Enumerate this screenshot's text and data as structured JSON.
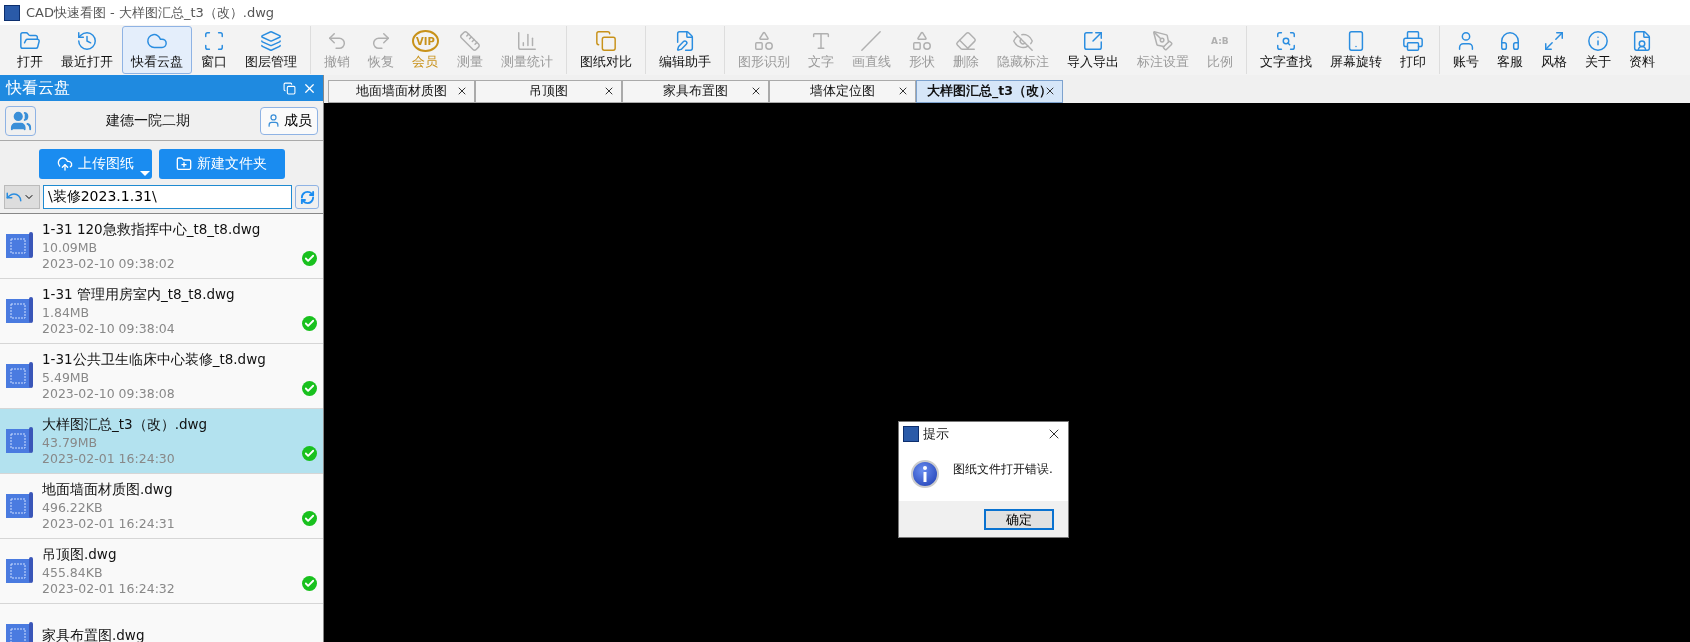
{
  "window": {
    "title": "CAD快速看图 - 大样图汇总_t3（改）.dwg"
  },
  "toolbar": {
    "groups": [
      [
        {
          "label": "打开",
          "disabled": false,
          "selected": false
        },
        {
          "label": "最近打开",
          "disabled": false,
          "selected": false
        },
        {
          "label": "快看云盘",
          "disabled": false,
          "selected": true
        },
        {
          "label": "窗口",
          "disabled": false,
          "selected": false
        },
        {
          "label": "图层管理",
          "disabled": false,
          "selected": false
        }
      ],
      [
        {
          "label": "撤销",
          "disabled": true,
          "selected": false
        },
        {
          "label": "恢复",
          "disabled": true,
          "selected": false
        },
        {
          "label": "会员",
          "badge": "VIP",
          "color": "#c8921a",
          "disabled": false,
          "selected": false
        },
        {
          "label": "测量",
          "disabled": true,
          "selected": false
        },
        {
          "label": "测量统计",
          "disabled": true,
          "selected": false
        }
      ],
      [
        {
          "label": "图纸对比",
          "disabled": false,
          "selected": false
        }
      ],
      [
        {
          "label": "编辑助手",
          "disabled": false,
          "selected": false
        }
      ],
      [
        {
          "label": "图形识别",
          "disabled": true,
          "selected": false
        },
        {
          "label": "文字",
          "disabled": true,
          "selected": false
        },
        {
          "label": "画直线",
          "disabled": true,
          "selected": false
        },
        {
          "label": "形状",
          "disabled": true,
          "selected": false
        },
        {
          "label": "删除",
          "disabled": true,
          "selected": false
        },
        {
          "label": "隐藏标注",
          "disabled": true,
          "selected": false
        },
        {
          "label": "导入导出",
          "disabled": false,
          "selected": false
        },
        {
          "label": "标注设置",
          "disabled": true,
          "selected": false
        },
        {
          "label": "比例",
          "badge": "A:B",
          "disabled": true,
          "selected": false
        }
      ],
      [
        {
          "label": "文字查找",
          "disabled": false,
          "selected": false
        },
        {
          "label": "屏幕旋转",
          "disabled": false,
          "selected": false
        },
        {
          "label": "打印",
          "disabled": false,
          "selected": false
        }
      ],
      [
        {
          "label": "账号",
          "disabled": false,
          "selected": false
        },
        {
          "label": "客服",
          "disabled": false,
          "selected": false
        },
        {
          "label": "风格",
          "disabled": false,
          "selected": false
        },
        {
          "label": "关于",
          "disabled": false,
          "selected": false
        },
        {
          "label": "资料",
          "disabled": false,
          "selected": false
        }
      ]
    ]
  },
  "sidebar": {
    "title": "快看云盘",
    "project": "建德一院二期",
    "members_button": "成员",
    "upload_button": "上传图纸",
    "new_folder_button": "新建文件夹",
    "path": "\\装修2023.1.31\\",
    "files": [
      {
        "name": "1-31 120急救指挥中心_t8_t8.dwg",
        "size": "10.09MB",
        "date": "2023-02-10 09:38:02",
        "synced": true,
        "selected": false
      },
      {
        "name": "1-31 管理用房室内_t8_t8.dwg",
        "size": "1.84MB",
        "date": "2023-02-10 09:38:04",
        "synced": true,
        "selected": false
      },
      {
        "name": "1-31公共卫生临床中心装修_t8.dwg",
        "size": "5.49MB",
        "date": "2023-02-10 09:38:08",
        "synced": true,
        "selected": false
      },
      {
        "name": "大样图汇总_t3（改）.dwg",
        "size": "43.79MB",
        "date": "2023-02-01 16:24:30",
        "synced": true,
        "selected": true
      },
      {
        "name": "地面墙面材质图.dwg",
        "size": "496.22KB",
        "date": "2023-02-01 16:24:31",
        "synced": true,
        "selected": false
      },
      {
        "name": "吊顶图.dwg",
        "size": "455.84KB",
        "date": "2023-02-01 16:24:32",
        "synced": true,
        "selected": false
      },
      {
        "name": "家具布置图.dwg",
        "synced": false,
        "selected": false
      }
    ]
  },
  "tabs": [
    {
      "label": "地面墙面材质图",
      "selected": false
    },
    {
      "label": "吊顶图",
      "selected": false
    },
    {
      "label": "家具布置图",
      "selected": false
    },
    {
      "label": "墙体定位图",
      "selected": false
    },
    {
      "label": "大样图汇总_t3（改）",
      "selected": true
    }
  ],
  "dialog": {
    "title": "提示",
    "message": "图纸文件打开错误.",
    "button": "确定"
  }
}
